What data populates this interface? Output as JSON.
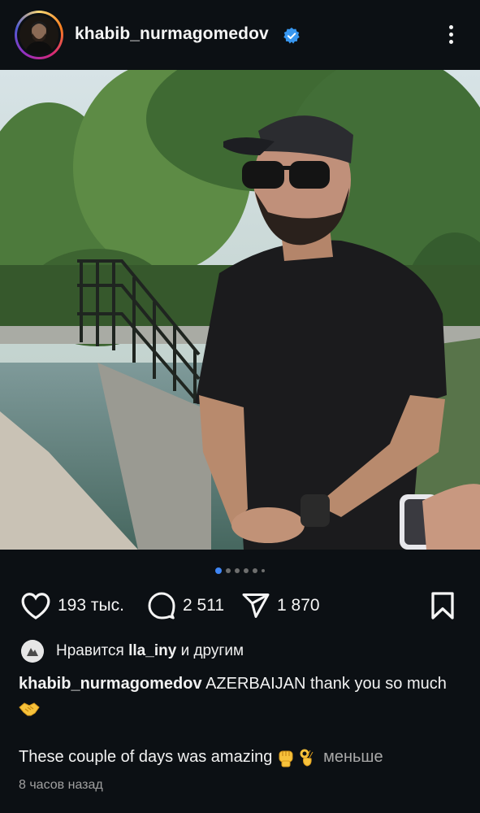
{
  "header": {
    "username": "khabib_nurmagomedov",
    "verified_icon": "verified-badge-icon",
    "more_icon": "more-vertical-icon"
  },
  "carousel": {
    "total_dots": 6,
    "active_index": 0
  },
  "actions": {
    "likes_count": "193 тыс.",
    "comments_count": "2 511",
    "shares_count": "1 870"
  },
  "liked_by": {
    "prefix": "Нравится",
    "user": "lla_iny",
    "suffix": "и другим"
  },
  "caption": {
    "username": "khabib_nurmagomedov",
    "line1": "AZERBAIJAN thank you so much",
    "line2": "These couple of days was amazing",
    "less_label": "меньше"
  },
  "timestamp": "8 часов назад",
  "colors": {
    "background": "#0c1014",
    "accent_blue": "#3f86f5",
    "verified_blue": "#3897f0",
    "secondary_text": "#a8a8a8"
  }
}
